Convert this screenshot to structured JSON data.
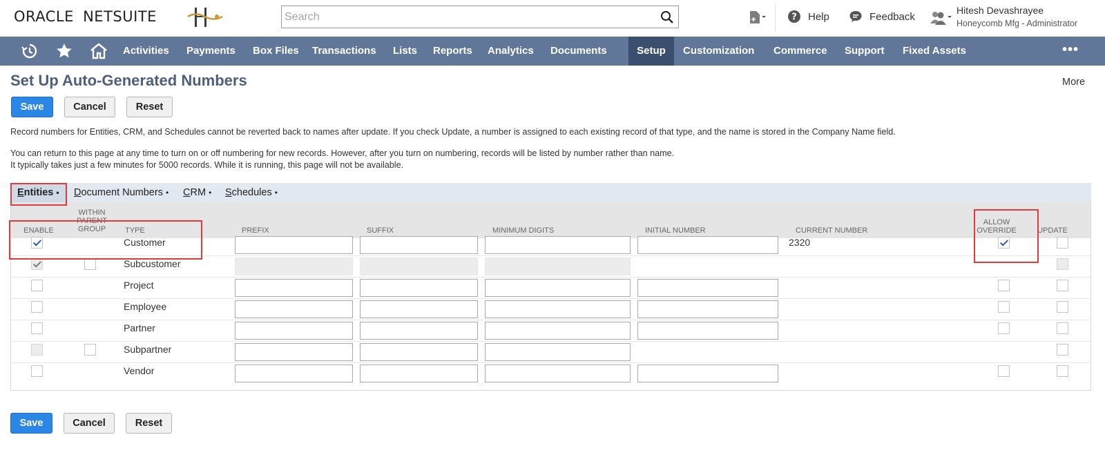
{
  "header": {
    "logo_oracle": "ORACLE",
    "logo_netsuite": "NETSUITE",
    "search_placeholder": "Search",
    "help_label": "Help",
    "feedback_label": "Feedback",
    "user_name": "Hitesh Devashrayee",
    "user_role": "Honeycomb Mfg - Administrator"
  },
  "nav": {
    "items": [
      "Activities",
      "Payments",
      "Box Files",
      "Transactions",
      "Lists",
      "Reports",
      "Analytics",
      "Documents",
      "Setup",
      "Customization",
      "Commerce",
      "Support",
      "Fixed Assets"
    ],
    "active": "Setup",
    "more": "•••"
  },
  "page": {
    "title": "Set Up Auto-Generated Numbers",
    "more_label": "More",
    "save_label": "Save",
    "cancel_label": "Cancel",
    "reset_label": "Reset",
    "message1": "Record numbers for Entities, CRM, and Schedules cannot be reverted back to names after update. If you check Update, a number is assigned to each existing record of that type, and the name is stored in the Company Name field.",
    "message2": "You can return to this page at any time to turn on or off numbering for new records. However, after you turn on numbering, records will be listed by number rather than name.",
    "message3": "It typically takes just a few minutes for 5000 records. While it is running, this page will not be available."
  },
  "subtabs": {
    "entities_first": "E",
    "entities_rest": "ntities",
    "document_first": "D",
    "document_rest": "ocument Numbers",
    "crm_first": "C",
    "crm_rest": "RM",
    "schedules_first": "S",
    "schedules_rest": "chedules",
    "dot": "•"
  },
  "table": {
    "headers": {
      "enable": "ENABLE",
      "within": "WITHIN PARENT GROUP",
      "type": "TYPE",
      "prefix": "PREFIX",
      "suffix": "SUFFIX",
      "min_digits": "MINIMUM DIGITS",
      "initial": "INITIAL NUMBER",
      "current": "CURRENT NUMBER",
      "allow": "ALLOW OVERRIDE",
      "update": "UPDATE"
    },
    "rows": [
      {
        "type": "Customer",
        "current": "2320",
        "enable": "checked",
        "allow": "checked"
      },
      {
        "type": "Subcustomer",
        "current": "",
        "enable": "checked-disabled",
        "allow": "none"
      },
      {
        "type": "Project",
        "current": "",
        "enable": "unchecked",
        "allow": "unchecked"
      },
      {
        "type": "Employee",
        "current": "",
        "enable": "unchecked",
        "allow": "unchecked"
      },
      {
        "type": "Partner",
        "current": "",
        "enable": "unchecked",
        "allow": "unchecked"
      },
      {
        "type": "Subpartner",
        "current": "",
        "enable": "disabled",
        "allow": "none"
      },
      {
        "type": "Vendor",
        "current": "",
        "enable": "unchecked",
        "allow": "unchecked"
      }
    ]
  },
  "colors": {
    "navbar": "#607799",
    "nav_active": "#3a4e6d",
    "primary_button": "#2c86e5",
    "title": "#4d5f79",
    "highlight": "#e03a3a"
  }
}
